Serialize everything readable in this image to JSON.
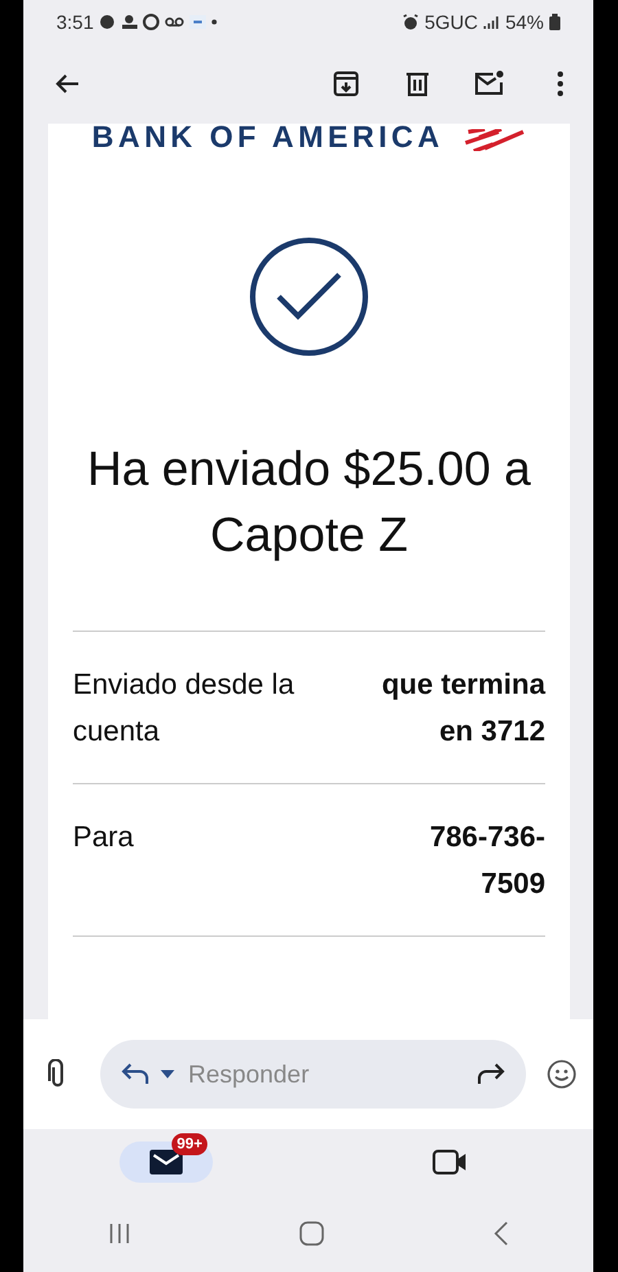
{
  "status_bar": {
    "time": "3:51",
    "network": "5GUC",
    "battery": "54%"
  },
  "email": {
    "brand": "BANK OF AMERICA",
    "headline": "Ha enviado $25.00 a Capote Z",
    "details": [
      {
        "label": "Enviado desde la cuenta",
        "value": "que termina en 3712"
      },
      {
        "label": "Para",
        "value": "786-736-7509"
      }
    ]
  },
  "reply": {
    "placeholder": "Responder"
  },
  "bottom_nav": [
    {
      "kind": "mail",
      "badge": "99+",
      "selected": true
    },
    {
      "kind": "video",
      "selected": false
    }
  ]
}
